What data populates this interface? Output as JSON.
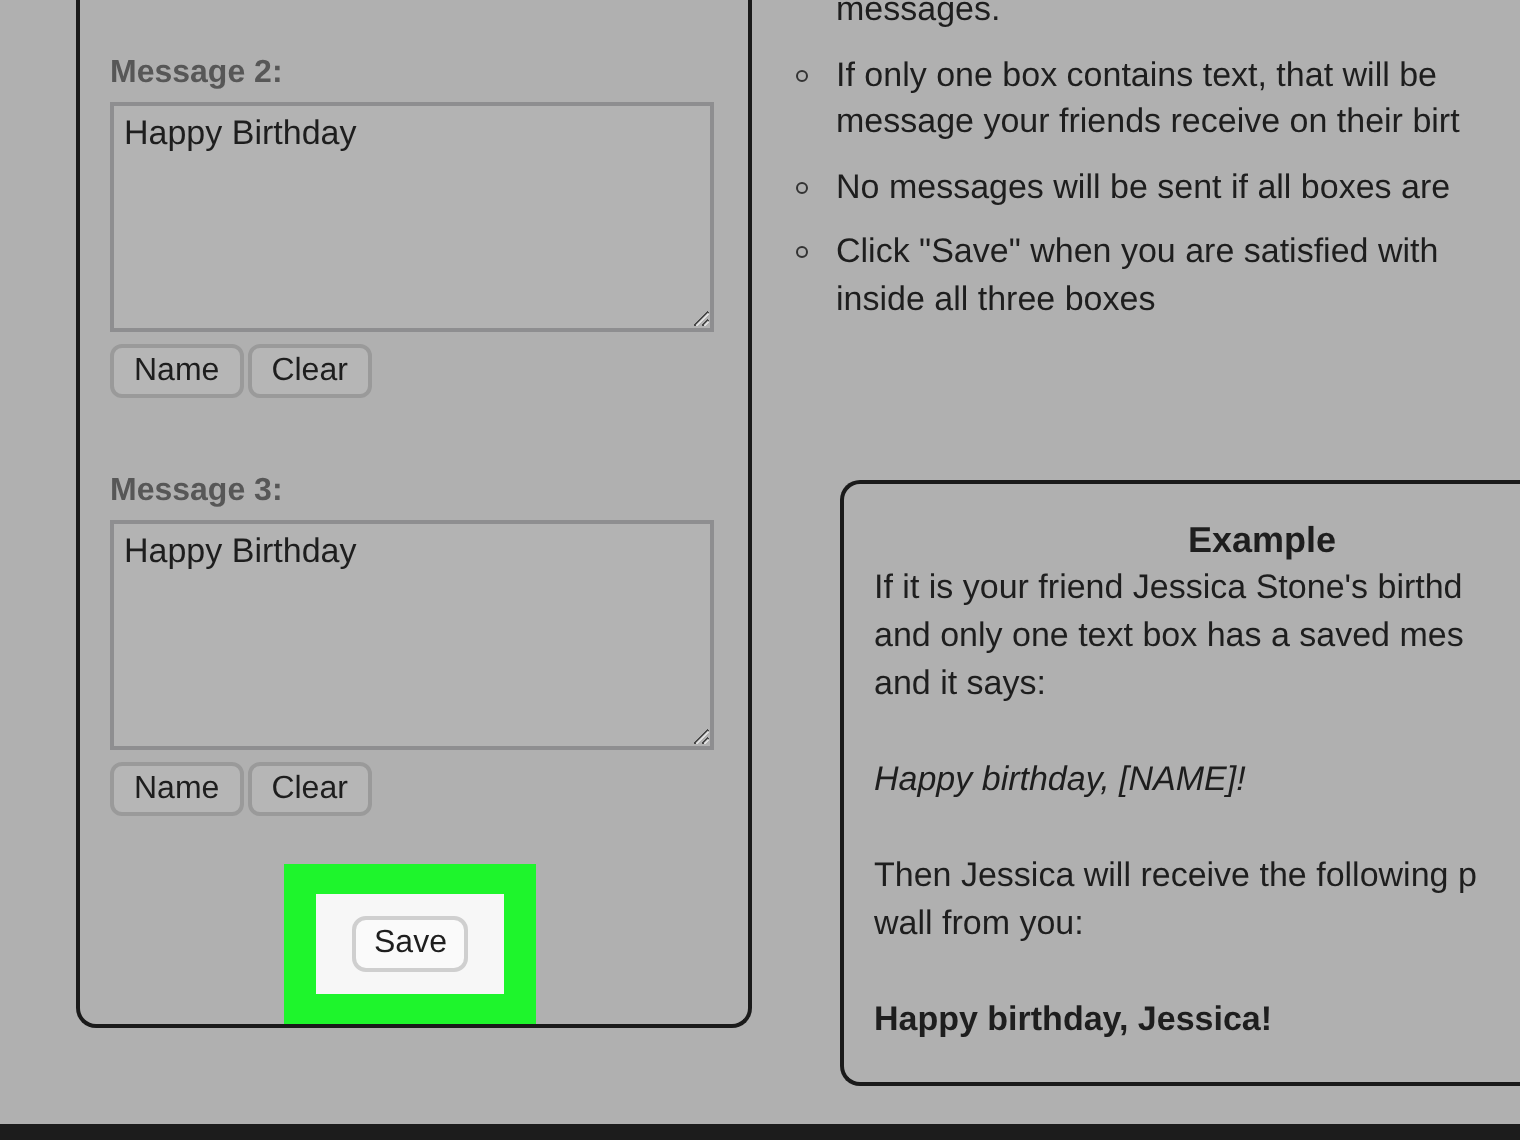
{
  "form": {
    "messages": [
      {
        "label": "Message 2:",
        "value": "Happy Birthday",
        "buttons": [
          "Name",
          "Clear"
        ]
      },
      {
        "label": "Message 3:",
        "value": "Happy Birthday",
        "buttons": [
          "Name",
          "Clear"
        ]
      }
    ],
    "save_button": {
      "label": "Save",
      "highlighted": true
    }
  },
  "instructions": [
    {
      "kind": "continuation",
      "lines": [
        "messages."
      ]
    },
    {
      "kind": "bullet",
      "lines": [
        "If only one box contains text, that will be",
        "message your friends receive on their birt"
      ]
    },
    {
      "kind": "bullet",
      "lines": [
        "No messages will be sent if all boxes are"
      ]
    },
    {
      "kind": "bullet",
      "lines": [
        "Click \"Save\" when you are satisfied with",
        "inside all three boxes"
      ]
    }
  ],
  "example": {
    "title": "Example",
    "paragraphs": [
      {
        "kind": "plain",
        "lines": [
          "If it is your friend Jessica Stone's birthd",
          "and only one text box has a saved mes",
          "and it says:"
        ]
      },
      {
        "kind": "italic",
        "lines": [
          "Happy birthday, [NAME]!"
        ]
      },
      {
        "kind": "plain",
        "lines": [
          "Then Jessica will receive the following p",
          "wall from you:"
        ]
      },
      {
        "kind": "bold",
        "lines": [
          "Happy birthday, Jessica!"
        ]
      }
    ]
  }
}
